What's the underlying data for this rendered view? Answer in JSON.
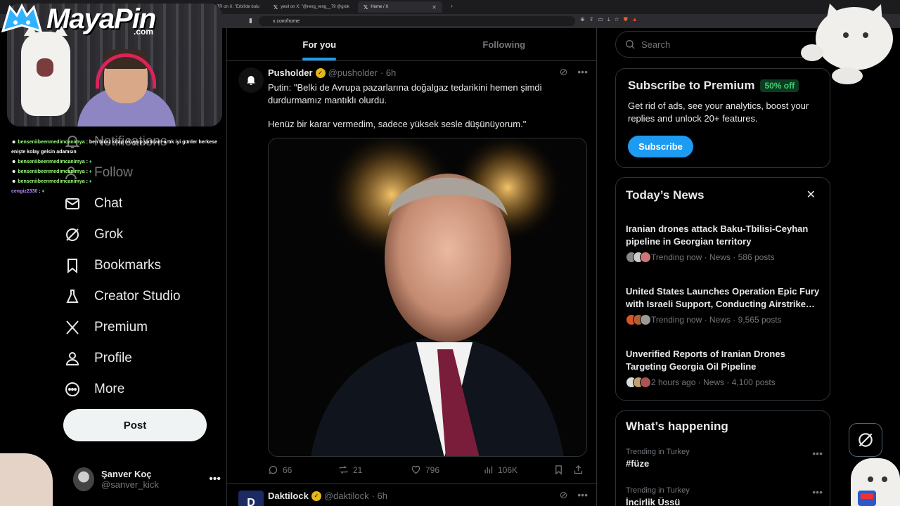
{
  "browser": {
    "tabs": [
      {
        "label": "TR on X: \"Erbil'de bulu"
      },
      {
        "label": "yesil on X: \"@reng_reng__79 @grok"
      },
      {
        "label": "Home / X"
      }
    ],
    "url": "x.com/home"
  },
  "overlay": {
    "logo_main": "MayaPin",
    "logo_sub": ".com",
    "chat": [
      {
        "user": "benseniibeenmedimcanimya",
        "msg": ": ben biraz kitap okuyup yatıcam artık iyi günler herkese enişte kolay gelsin adamsın"
      },
      {
        "user": "benseniibeenmedimcanimya",
        "msg": ":"
      },
      {
        "user": "benseniibeenmedimcanimya",
        "msg": ":"
      },
      {
        "user": "benseniibeenmedimcanimya",
        "msg": ":"
      },
      {
        "user": "cengiz2330",
        "msg": ":"
      }
    ]
  },
  "nav": {
    "items": [
      {
        "label": "Notifications"
      },
      {
        "label": "Follow"
      },
      {
        "label": "Chat"
      },
      {
        "label": "Grok"
      },
      {
        "label": "Bookmarks"
      },
      {
        "label": "Creator Studio"
      },
      {
        "label": "Premium"
      },
      {
        "label": "Profile"
      },
      {
        "label": "More"
      }
    ],
    "post_label": "Post",
    "account": {
      "display_name": "Şanver Koç",
      "handle": "@sanver_kick"
    }
  },
  "feed": {
    "tabs": [
      {
        "label": "For you"
      },
      {
        "label": "Following"
      }
    ],
    "tweets": [
      {
        "name": "Pusholder",
        "handle": "@pusholder",
        "time": "· 6h",
        "text_line1": "Putin: \"Belki de Avrupa pazarlarına doğalgaz tedarikini hemen şimdi durdurmamız mantıklı olurdu.",
        "text_line2": "Henüz bir karar vermedim, sadece yüksek sesle düşünüyorum.\"",
        "replies": "66",
        "reposts": "21",
        "likes": "796",
        "views": "106K"
      },
      {
        "name": "Daktilock",
        "handle": "@daktilock",
        "time": "· 6h"
      }
    ]
  },
  "right": {
    "search_placeholder": "Search",
    "premium": {
      "title": "Subscribe to Premium",
      "badge": "50% off",
      "description": "Get rid of ads, see your analytics, boost your replies and unlock 20+ features.",
      "button": "Subscribe"
    },
    "news": {
      "title": "Today’s News",
      "items": [
        {
          "headline": "Iranian drones attack Baku-Tbilisi-Ceyhan pipeline in Georgian territory",
          "meta": "Trending now · News · 586 posts"
        },
        {
          "headline": "United States Launches Operation Epic Fury with Israeli Support, Conducting Airstrike…",
          "meta": "Trending now · News · 9,565 posts"
        },
        {
          "headline": "Unverified Reports of Iranian Drones Targeting Georgia Oil Pipeline",
          "meta": "2 hours ago · News · 4,100 posts"
        }
      ]
    },
    "happening": {
      "title": "What’s happening",
      "trends": [
        {
          "label": "Trending in Turkey",
          "topic": "#füze"
        },
        {
          "label": "Trending in Turkey",
          "topic": "İncirlik Üssü"
        }
      ]
    }
  },
  "colors": {
    "accent": "#1d9bf0",
    "verified": "#e2b719",
    "premium_badge": "#3bd16f"
  }
}
